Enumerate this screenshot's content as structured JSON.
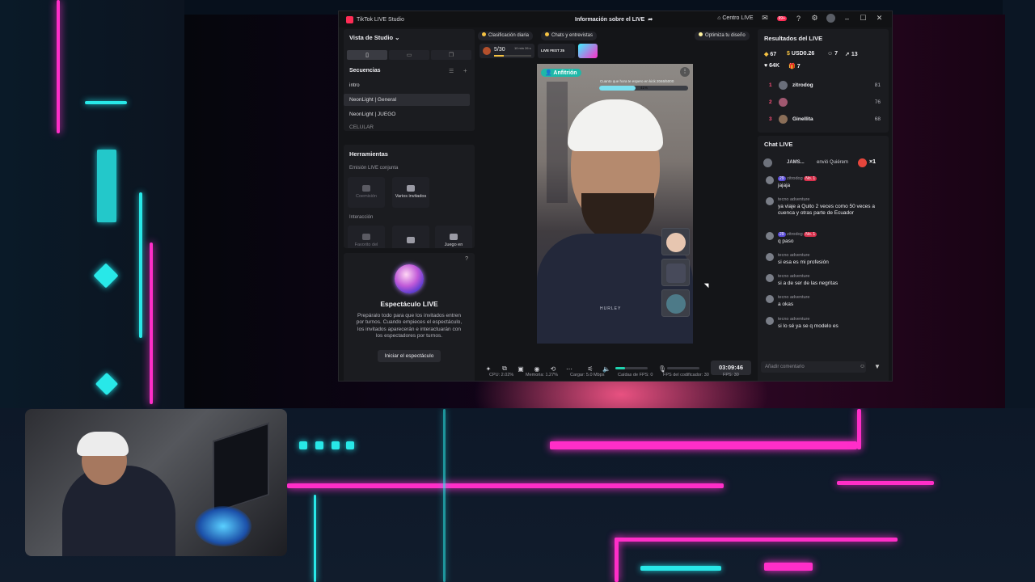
{
  "app": {
    "title": "TikTok LIVE Studio",
    "live_info": "Información sobre el LIVE",
    "centro_live": "Centro LIVE",
    "notif_badge": "99+"
  },
  "left": {
    "studio_view": "Vista de Studio",
    "sequences_title": "Secuencias",
    "sequences": [
      "intro",
      "NeonLight | General",
      "NeonLight | JUEGO",
      "CELULAR"
    ],
    "tools_title": "Herramientas",
    "cohost_label": "Emisión LIVE conjunta",
    "cohost_tools": [
      "Coemisión",
      "Varios invitados"
    ],
    "interaction_label": "Interacción",
    "interaction_tools": [
      "Favorito del",
      "",
      "Juego en"
    ],
    "espect_title": "Espectáculo LIVE",
    "espect_desc": "Prepáralo todo para que los invitados entren por turnos. Cuando empieces el espectáculo, los invitados aparecerán e interactuarán con los espectadores por turnos.",
    "espect_button": "Iniciar el espectáculo"
  },
  "center": {
    "chip_ranking": "Clasificación diaria",
    "chip_chats": "Chats y entrevistas",
    "chip_optimize": "Optimiza tu diseño",
    "goal_progress": "5/30",
    "goal_time": "10 min 26 s",
    "fest_label": "LIVE FEST 25",
    "host_badge": "Anfitrión",
    "overlay_text": "Cuanto que hora te espero en kick  2046/5000",
    "overlay_percent": "41%",
    "overlay_fraction": 0.41,
    "shirt_text": "HURLEY",
    "timer": "03:09:46",
    "volume_level": 0.3,
    "mic_level": 0.0
  },
  "status": {
    "cpu": "CPU: 2.02%",
    "memory": "Memoria: 1.27%",
    "upload": "Cargar: 5.0 Mbps",
    "fps_drop": "Caídas de FPS: 0",
    "encoder_fps": "FPS del codificador: 30",
    "fps": "FPS: 30"
  },
  "results": {
    "title": "Resultados del LIVE",
    "diamonds": "67",
    "usd": "USD0.26",
    "viewers": "7",
    "shares": "13",
    "likes": "64K",
    "gifts": "7",
    "ranking": [
      {
        "rank": "1",
        "name": "zitrodog",
        "score": "81"
      },
      {
        "rank": "2",
        "name": "",
        "score": "76"
      },
      {
        "rank": "3",
        "name": "Ginellita",
        "score": "68"
      }
    ]
  },
  "chat": {
    "title": "Chat LIVE",
    "gift_line_user": "JAMS...",
    "gift_line_text": "envió Quiérem",
    "gift_count": "×1",
    "messages": [
      {
        "name": "zitrodog",
        "level": "29",
        "badge": "No. 1",
        "text": "jajaja"
      },
      {
        "name": "tecno adventure",
        "level": "",
        "badge": "",
        "text": "ya viaje a Quito 2 veces como 50 veces a cuenca y otras parte de Ecuador"
      },
      {
        "name": "zitrodog",
        "level": "29",
        "badge": "No. 1",
        "text": "q paso"
      },
      {
        "name": "tecno adventure",
        "level": "",
        "badge": "",
        "text": "si esa es mi profesión"
      },
      {
        "name": "tecno adventure",
        "level": "",
        "badge": "",
        "text": "si a de ser de las negritas"
      },
      {
        "name": "tecno adventure",
        "level": "",
        "badge": "",
        "text": "a okas"
      },
      {
        "name": "tecno adventure",
        "level": "",
        "badge": "",
        "text": "si lo sé ya se q modelo es"
      }
    ],
    "comment_placeholder": "Añadir comentario"
  },
  "colors": {
    "accent_pink": "#fe2c55",
    "accent_teal": "#1fb8a8",
    "neon_cyan": "#28e8e8",
    "neon_pink": "#ff2ec8"
  }
}
